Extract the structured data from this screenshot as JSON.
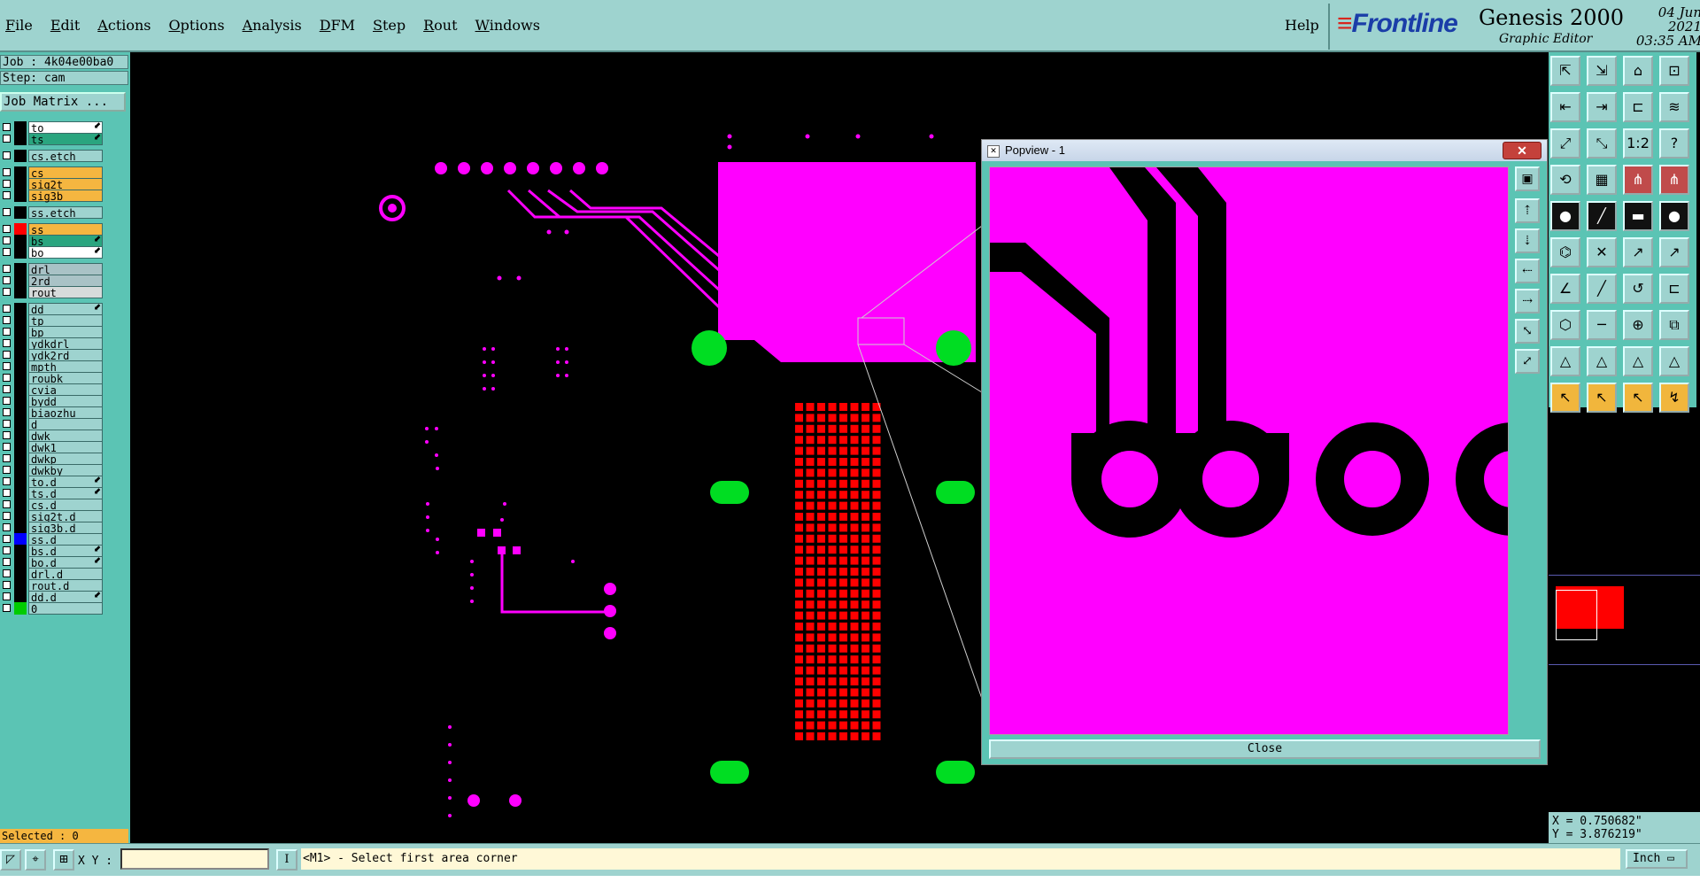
{
  "menu": {
    "items": [
      "File",
      "Edit",
      "Actions",
      "Options",
      "Analysis",
      "DFM",
      "Step",
      "Rout",
      "Windows"
    ],
    "help": "Help"
  },
  "brand": {
    "logo": "Frontline",
    "product": "Genesis 2000",
    "subtitle": "Graphic Editor",
    "date": "04 Jun 2021",
    "time": "03:35 AM"
  },
  "job": {
    "job_label": "Job : 4k04e00ba0",
    "step_label": "Step: cam",
    "matrix_button": "Job Matrix ..."
  },
  "layers": [
    {
      "name": "to",
      "color": "white",
      "swatch": "#000000",
      "arrow": true
    },
    {
      "name": "ts",
      "color": "green",
      "swatch": "#000000",
      "arrow": true
    },
    {
      "name": "cs.etch",
      "color": "cyan",
      "swatch": "#000000",
      "arrow": false
    },
    {
      "name": "cs",
      "color": "orange",
      "swatch": "#000000",
      "arrow": false
    },
    {
      "name": "sig2t",
      "color": "orange",
      "swatch": "#000000",
      "arrow": false
    },
    {
      "name": "sig3b",
      "color": "orange",
      "swatch": "#000000",
      "arrow": false
    },
    {
      "name": "ss.etch",
      "color": "cyan",
      "swatch": "#000000",
      "arrow": false
    },
    {
      "name": "ss",
      "color": "orange",
      "swatch": "#ff0000",
      "arrow": false
    },
    {
      "name": "bs",
      "color": "green",
      "swatch": "#000000",
      "arrow": true
    },
    {
      "name": "bo",
      "color": "white",
      "swatch": "#000000",
      "arrow": true
    },
    {
      "name": "drl",
      "color": "grey",
      "swatch": "#000000",
      "arrow": false
    },
    {
      "name": "2rd",
      "color": "grey",
      "swatch": "#000000",
      "arrow": false
    },
    {
      "name": "rout",
      "color": "ltgrey",
      "swatch": "#000000",
      "arrow": false
    },
    {
      "name": "dd",
      "color": "cyan",
      "swatch": "#000000",
      "arrow": true
    },
    {
      "name": "tp",
      "color": "cyan",
      "swatch": "#000000",
      "arrow": false
    },
    {
      "name": "bp",
      "color": "cyan",
      "swatch": "#000000",
      "arrow": false
    },
    {
      "name": "ydkdrl",
      "color": "cyan",
      "swatch": "#000000",
      "arrow": false
    },
    {
      "name": "ydk2rd",
      "color": "cyan",
      "swatch": "#000000",
      "arrow": false
    },
    {
      "name": "mpth",
      "color": "cyan",
      "swatch": "#000000",
      "arrow": false
    },
    {
      "name": "roubk",
      "color": "cyan",
      "swatch": "#000000",
      "arrow": false
    },
    {
      "name": "cvia",
      "color": "cyan",
      "swatch": "#000000",
      "arrow": false
    },
    {
      "name": "bydd",
      "color": "cyan",
      "swatch": "#000000",
      "arrow": false
    },
    {
      "name": "biaozhu",
      "color": "cyan",
      "swatch": "#000000",
      "arrow": false
    },
    {
      "name": "d",
      "color": "cyan",
      "swatch": "#000000",
      "arrow": false
    },
    {
      "name": "dwk",
      "color": "cyan",
      "swatch": "#000000",
      "arrow": false
    },
    {
      "name": "dwk1",
      "color": "cyan",
      "swatch": "#000000",
      "arrow": false
    },
    {
      "name": "dwkp",
      "color": "cyan",
      "swatch": "#000000",
      "arrow": false
    },
    {
      "name": "dwkby",
      "color": "cyan",
      "swatch": "#000000",
      "arrow": false
    },
    {
      "name": "to.d",
      "color": "cyan",
      "swatch": "#000000",
      "arrow": true
    },
    {
      "name": "ts.d",
      "color": "cyan",
      "swatch": "#000000",
      "arrow": true
    },
    {
      "name": "cs.d",
      "color": "cyan",
      "swatch": "#000000",
      "arrow": false
    },
    {
      "name": "sig2t.d",
      "color": "cyan",
      "swatch": "#000000",
      "arrow": false
    },
    {
      "name": "sig3b.d",
      "color": "cyan",
      "swatch": "#000000",
      "arrow": false
    },
    {
      "name": "ss.d",
      "color": "cyan",
      "swatch": "#0000ff",
      "arrow": false
    },
    {
      "name": "bs.d",
      "color": "cyan",
      "swatch": "#000000",
      "arrow": true
    },
    {
      "name": "bo.d",
      "color": "cyan",
      "swatch": "#000000",
      "arrow": true
    },
    {
      "name": "drl.d",
      "color": "cyan",
      "swatch": "#000000",
      "arrow": false
    },
    {
      "name": "rout.d",
      "color": "cyan",
      "swatch": "#000000",
      "arrow": false
    },
    {
      "name": "dd.d",
      "color": "cyan",
      "swatch": "#000000",
      "arrow": true
    },
    {
      "name": "0",
      "color": "cyan",
      "swatch": "#00cc00",
      "arrow": false
    }
  ],
  "selected": "Selected : 0",
  "popview": {
    "title": "Popview - 1",
    "close_x": "✕",
    "close_button": "Close"
  },
  "status": {
    "xy_label": "X Y :",
    "xy_value": "",
    "prompt": "<M1> - Select first area corner",
    "unit": "Inch"
  },
  "coords": {
    "x": "X = 0.750682\"",
    "y": "Y = 3.876219\""
  },
  "colors": {
    "panel": "#5bc4b4",
    "menubar": "#9ed3cf",
    "copper": "#ff00ff",
    "pad_green": "#00dd22",
    "pad_red": "#ff0000"
  }
}
